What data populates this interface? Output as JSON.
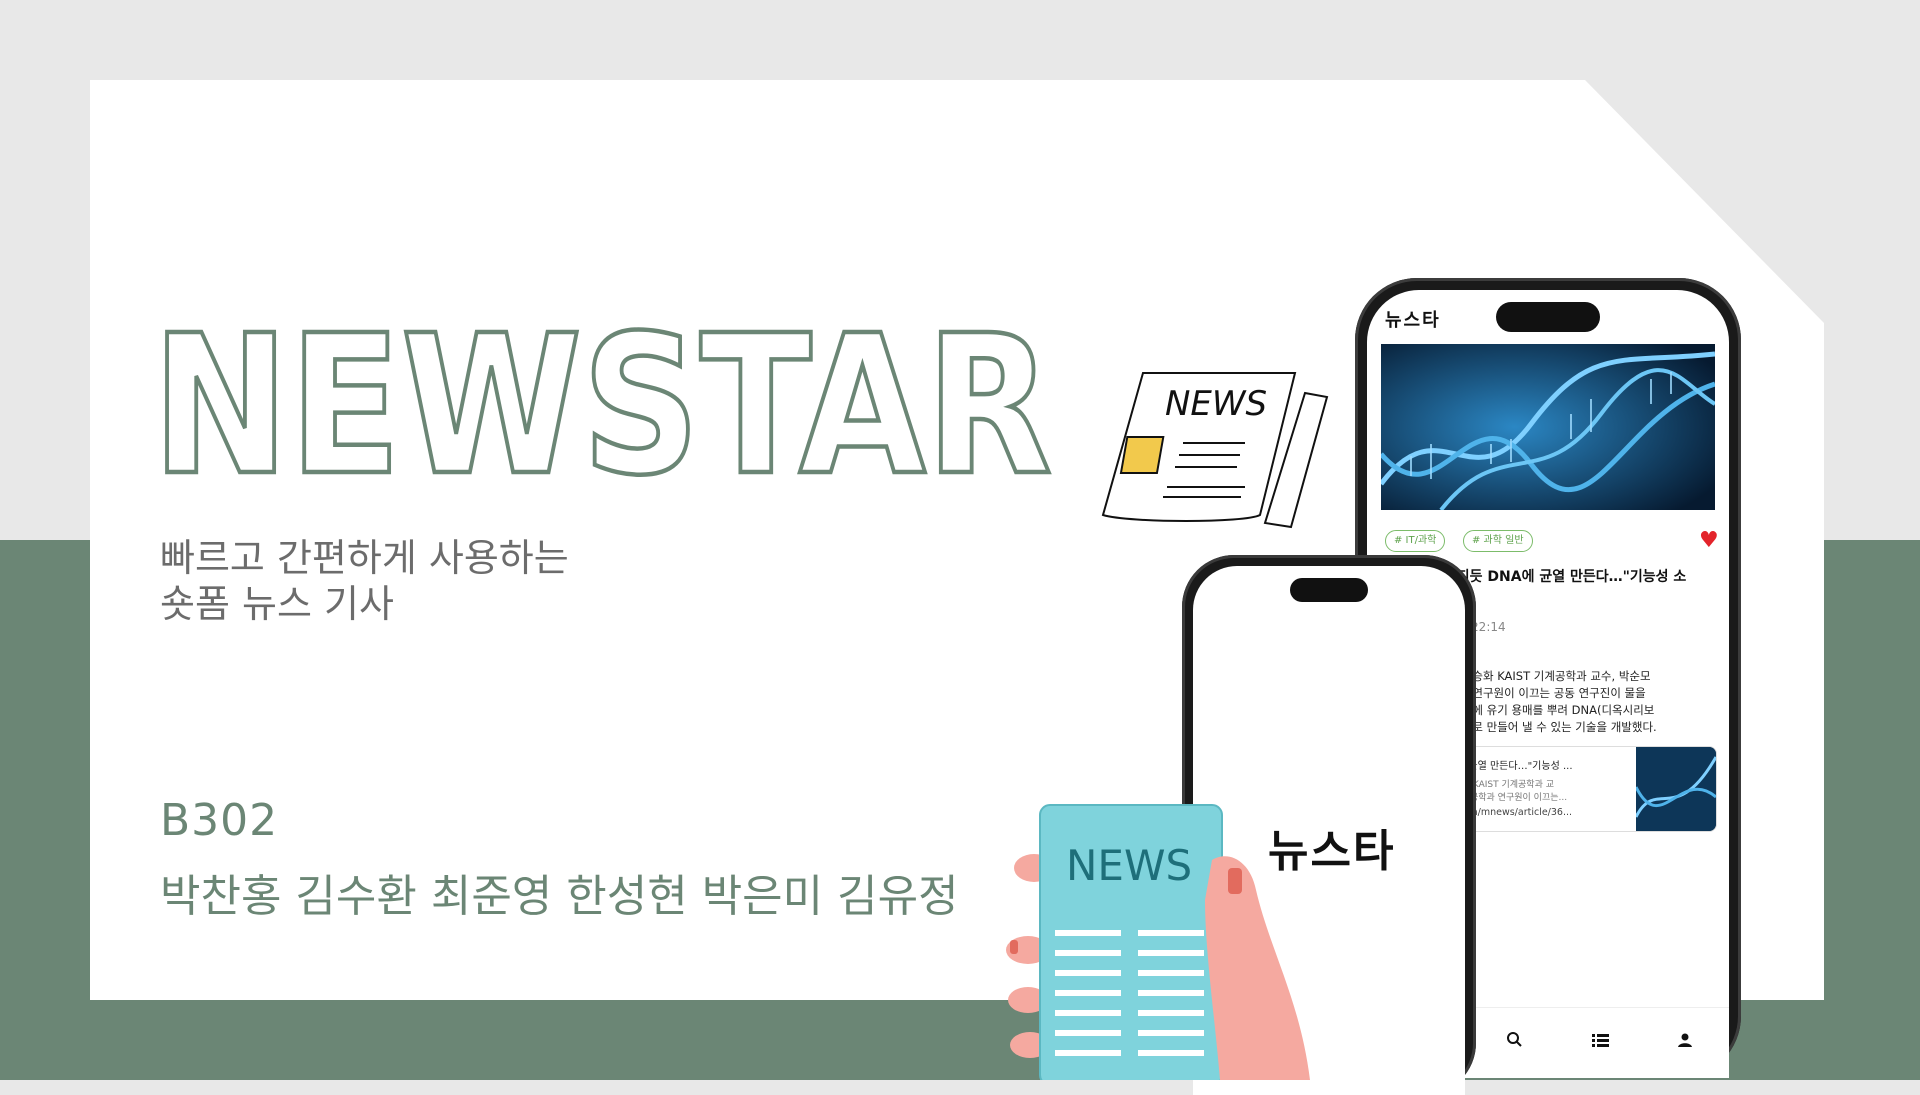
{
  "title": "NEWSTAR",
  "subtitle": {
    "line1": "빠르고 간편하게 사용하는",
    "line2": "숏폼 뉴스 기사"
  },
  "team": {
    "code": "B302",
    "members": "박찬홍 김수환 최준영 한성현 박은미 김유정"
  },
  "illustration": {
    "newspaper_label": "NEWS",
    "tablet_label": "NEWS"
  },
  "app": {
    "logo": "뉴스타",
    "splash_logo": "뉴스타",
    "tags": [
      "# IT/과학",
      "# 과학 일반"
    ],
    "article_title": "칼라지듯 DNA에 균열 만든다…\"기능성 소",
    "article_time": ":22:14",
    "article_body": [
      "수와 유승화 KAIST 기계공학과 교수, 박순모",
      "공학과 연구원이 이끄는 공동 연구진이 물을",
      "박막 위에 유기 용매를 뿌려 DNA(디옥시리보",
      "하는 대로 만들어 낼 수 있는 기술을 개발했다."
    ],
    "link_title": "DNA에 균열 만든다…\"기능성 ...",
    "link_desc1": "와 유승화 KAIST 기계공학과 교",
    "link_desc2": "화대 화학공학과 연구원이 이끄는...",
    "link_url": "aver.com/mnews/article/36...",
    "icons": [
      "heart-icon",
      "search-icon",
      "list-icon",
      "person-icon"
    ],
    "accent_color": "#7cbc6a",
    "heart_color": "#e3242b"
  },
  "colors": {
    "brand_green": "#6b8675",
    "background_gray": "#e8e8e8"
  }
}
